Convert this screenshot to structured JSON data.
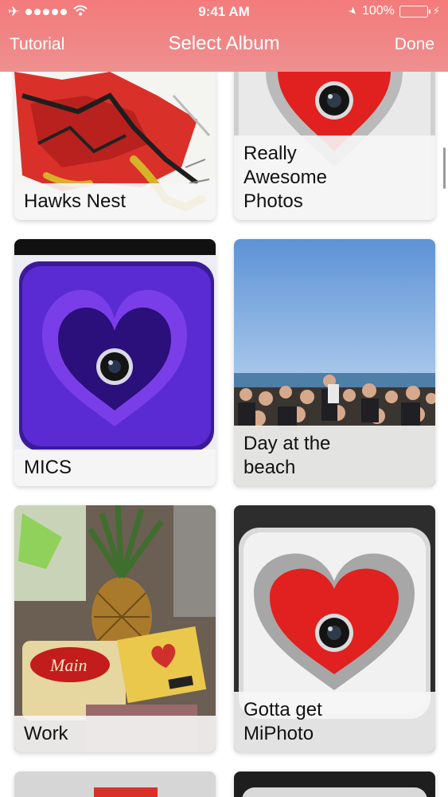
{
  "status_bar": {
    "time": "9:41 AM",
    "battery_percent": "100%",
    "battery_level": 1.0,
    "icons": [
      "airplane-icon",
      "signal-dots-icon",
      "wifi-icon",
      "location-arrow-icon",
      "battery-icon",
      "charging-bolt-icon"
    ]
  },
  "nav": {
    "left_label": "Tutorial",
    "title": "Select Album",
    "right_label": "Done"
  },
  "colors": {
    "header": "#f47b7b",
    "caption_bg": "#f6f6f6",
    "text": "#111111"
  },
  "albums": [
    {
      "name": "Hawks Nest",
      "image": "hawk-drawing"
    },
    {
      "name": "Really\nAwesome\nPhotos",
      "image": "silver-heart"
    },
    {
      "name": "MICS",
      "image": "purple-heart"
    },
    {
      "name": "Day at the\nbeach",
      "image": "beach-crowd"
    },
    {
      "name": "Work",
      "image": "pineapple-groceries"
    },
    {
      "name": "Gotta get\nMiPhoto",
      "image": "silver-heart"
    }
  ]
}
